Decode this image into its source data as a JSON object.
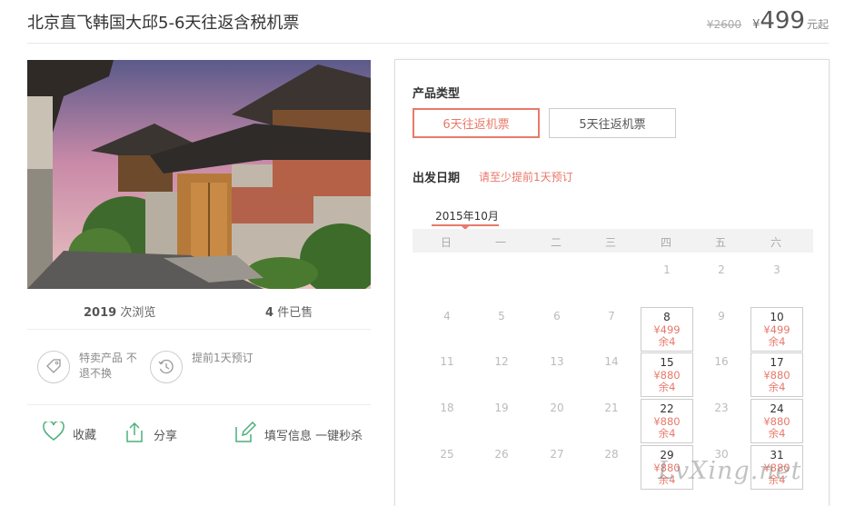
{
  "header": {
    "title": "北京直飞韩国大邱5-6天往返含税机票",
    "old_price": "¥2600",
    "currency": "¥",
    "price": "499",
    "price_suffix": "元起"
  },
  "stats": {
    "views_count": "2019",
    "views_label": "次浏览",
    "sold_count": "4",
    "sold_label": "件已售"
  },
  "features": [
    {
      "icon": "tag-icon",
      "text": "特卖产品 不退不换"
    },
    {
      "icon": "clock-history-icon",
      "text": "提前1天预订"
    }
  ],
  "actions": {
    "favorite": "收藏",
    "share": "分享",
    "fill_info": "填写信息 一键秒杀"
  },
  "booking": {
    "product_type_label": "产品类型",
    "types": [
      "6天往返机票",
      "5天往返机票"
    ],
    "selected_type": "6天往返机票",
    "date_label": "出发日期",
    "date_hint": "请至少提前1天预订",
    "month": "2015年10月",
    "weekdays": [
      "日",
      "一",
      "二",
      "三",
      "四",
      "五",
      "六"
    ],
    "rows": [
      [
        null,
        null,
        null,
        null,
        {
          "d": "1"
        },
        {
          "d": "2"
        },
        {
          "d": "3"
        }
      ],
      [
        {
          "d": "4"
        },
        {
          "d": "5"
        },
        {
          "d": "6"
        },
        {
          "d": "7"
        },
        {
          "d": "8",
          "p": "¥499",
          "r": "余4"
        },
        {
          "d": "9"
        },
        {
          "d": "10",
          "p": "¥499",
          "r": "余4"
        }
      ],
      [
        {
          "d": "11"
        },
        {
          "d": "12"
        },
        {
          "d": "13"
        },
        {
          "d": "14"
        },
        {
          "d": "15",
          "p": "¥880",
          "r": "余4"
        },
        {
          "d": "16"
        },
        {
          "d": "17",
          "p": "¥880",
          "r": "余4"
        }
      ],
      [
        {
          "d": "18"
        },
        {
          "d": "19"
        },
        {
          "d": "20"
        },
        {
          "d": "21"
        },
        {
          "d": "22",
          "p": "¥880",
          "r": "余4"
        },
        {
          "d": "23"
        },
        {
          "d": "24",
          "p": "¥880",
          "r": "余4"
        }
      ],
      [
        {
          "d": "25"
        },
        {
          "d": "26"
        },
        {
          "d": "27"
        },
        {
          "d": "28"
        },
        {
          "d": "29",
          "p": "¥880",
          "r": "余4"
        },
        {
          "d": "30"
        },
        {
          "d": "31",
          "p": "¥880",
          "r": "余4"
        }
      ]
    ]
  },
  "watermark": "LvXing.net",
  "colors": {
    "accent": "#e8796b",
    "icon_green": "#4caf7a"
  }
}
